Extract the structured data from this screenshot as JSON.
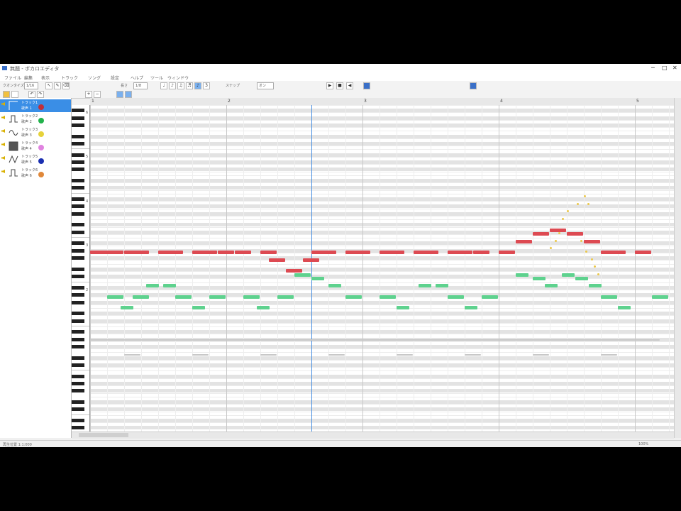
{
  "window": {
    "title": "無題 - ボカロエディタ",
    "minimize": "─",
    "maximize": "□",
    "close": "✕"
  },
  "menubar": [
    "ファイル",
    "編集",
    "表示",
    "トラック",
    "ソング",
    "設定",
    "ヘルプ",
    "ツール",
    "ウィンドウ"
  ],
  "toolbar": {
    "quantize_label": "クオンタイズ",
    "quantize_value": "1/16",
    "length_label": "長さ",
    "length_value": "1/8",
    "snap_label": "スナップ",
    "snap_value": "オン"
  },
  "tracks": [
    {
      "name": "トラック1",
      "sub": "歌声 1",
      "color": "#c0303a",
      "wave": "none",
      "selected": true
    },
    {
      "name": "トラック2",
      "sub": "歌声 2",
      "color": "#22b24c",
      "wave": "square",
      "selected": false
    },
    {
      "name": "トラック3",
      "sub": "歌声 3",
      "color": "#e6d23a",
      "wave": "sine",
      "selected": false
    },
    {
      "name": "トラック4",
      "sub": "歌声 4",
      "color": "#e083e0",
      "wave": "noise",
      "selected": false
    },
    {
      "name": "トラック5",
      "sub": "歌声 5",
      "color": "#1a2fb0",
      "wave": "triangle",
      "selected": false
    },
    {
      "name": "トラック6",
      "sub": "歌声 6",
      "color": "#e0883a",
      "wave": "square",
      "selected": false
    }
  ],
  "ruler": [
    "1",
    "2",
    "3",
    "4",
    "5"
  ],
  "octave_labels": [
    "6",
    "5",
    "4",
    "3",
    "2"
  ],
  "status": {
    "left": "再生位置 1:1:000",
    "right": "100%"
  },
  "notes": {
    "red": [
      {
        "start": 0,
        "len": 2,
        "pitch": 0
      },
      {
        "start": 2,
        "len": 1.5,
        "pitch": 0
      },
      {
        "start": 4,
        "len": 1.5,
        "pitch": 0
      },
      {
        "start": 6,
        "len": 1.5,
        "pitch": 0
      },
      {
        "start": 7.5,
        "len": 1,
        "pitch": 0
      },
      {
        "start": 8.5,
        "len": 1,
        "pitch": 0
      },
      {
        "start": 10,
        "len": 1,
        "pitch": 0
      },
      {
        "start": 10.5,
        "len": 1,
        "pitch": -2
      },
      {
        "start": 11.5,
        "len": 1,
        "pitch": -5
      },
      {
        "start": 12.5,
        "len": 1,
        "pitch": -2
      },
      {
        "start": 13,
        "len": 1.5,
        "pitch": 0
      },
      {
        "start": 15,
        "len": 1.5,
        "pitch": 0
      },
      {
        "start": 17,
        "len": 1.5,
        "pitch": 0
      },
      {
        "start": 19,
        "len": 1.5,
        "pitch": 0
      },
      {
        "start": 21,
        "len": 1.5,
        "pitch": 0
      },
      {
        "start": 22.5,
        "len": 1,
        "pitch": 0
      },
      {
        "start": 24,
        "len": 1,
        "pitch": 0
      },
      {
        "start": 25,
        "len": 1,
        "pitch": 3
      },
      {
        "start": 26,
        "len": 1,
        "pitch": 5
      },
      {
        "start": 27,
        "len": 1,
        "pitch": 6
      },
      {
        "start": 28,
        "len": 1,
        "pitch": 5
      },
      {
        "start": 29,
        "len": 1,
        "pitch": 3
      },
      {
        "start": 30,
        "len": 1.5,
        "pitch": 0
      },
      {
        "start": 32,
        "len": 1,
        "pitch": 0
      }
    ],
    "green": [
      {
        "start": 1,
        "len": 1,
        "pitch": -12
      },
      {
        "start": 1.8,
        "len": 0.8,
        "pitch": -15
      },
      {
        "start": 2.5,
        "len": 1,
        "pitch": -12
      },
      {
        "start": 3.3,
        "len": 0.8,
        "pitch": -9
      },
      {
        "start": 4.3,
        "len": 0.8,
        "pitch": -9
      },
      {
        "start": 5,
        "len": 1,
        "pitch": -12
      },
      {
        "start": 6,
        "len": 0.8,
        "pitch": -15
      },
      {
        "start": 7,
        "len": 1,
        "pitch": -12
      },
      {
        "start": 9,
        "len": 1,
        "pitch": -12
      },
      {
        "start": 9.8,
        "len": 0.8,
        "pitch": -15
      },
      {
        "start": 11,
        "len": 1,
        "pitch": -12
      },
      {
        "start": 12,
        "len": 1,
        "pitch": -6
      },
      {
        "start": 13,
        "len": 0.8,
        "pitch": -7
      },
      {
        "start": 14,
        "len": 0.8,
        "pitch": -9
      },
      {
        "start": 15,
        "len": 1,
        "pitch": -12
      },
      {
        "start": 17,
        "len": 1,
        "pitch": -12
      },
      {
        "start": 18,
        "len": 0.8,
        "pitch": -15
      },
      {
        "start": 19.3,
        "len": 0.8,
        "pitch": -9
      },
      {
        "start": 20.3,
        "len": 0.8,
        "pitch": -9
      },
      {
        "start": 21,
        "len": 1,
        "pitch": -12
      },
      {
        "start": 22,
        "len": 0.8,
        "pitch": -15
      },
      {
        "start": 23,
        "len": 1,
        "pitch": -12
      },
      {
        "start": 25,
        "len": 0.8,
        "pitch": -6
      },
      {
        "start": 26,
        "len": 0.8,
        "pitch": -7
      },
      {
        "start": 26.7,
        "len": 0.8,
        "pitch": -9
      },
      {
        "start": 27.7,
        "len": 0.8,
        "pitch": -6
      },
      {
        "start": 28.5,
        "len": 0.8,
        "pitch": -7
      },
      {
        "start": 29.3,
        "len": 0.8,
        "pitch": -9
      },
      {
        "start": 30,
        "len": 1,
        "pitch": -12
      },
      {
        "start": 31,
        "len": 0.8,
        "pitch": -15
      },
      {
        "start": 33,
        "len": 1,
        "pitch": -12
      }
    ],
    "yellow_curve": [
      [
        29.2,
        13
      ],
      [
        29.0,
        15
      ],
      [
        28.6,
        13
      ],
      [
        28.0,
        11
      ],
      [
        27.7,
        9
      ],
      [
        27.5,
        5
      ],
      [
        27.3,
        3
      ],
      [
        27.0,
        1
      ],
      [
        28.8,
        3
      ],
      [
        29.1,
        0
      ],
      [
        29.4,
        -2
      ],
      [
        29.6,
        -4
      ],
      [
        29.8,
        -6
      ]
    ],
    "gray": [
      {
        "start": 0,
        "len": 33.5,
        "pitch": -24
      },
      {
        "start": 2,
        "len": 1,
        "pitch": -28
      },
      {
        "start": 6,
        "len": 1,
        "pitch": -28
      },
      {
        "start": 10,
        "len": 1,
        "pitch": -28
      },
      {
        "start": 14,
        "len": 1,
        "pitch": -28
      },
      {
        "start": 18,
        "len": 1,
        "pitch": -28
      },
      {
        "start": 22,
        "len": 1,
        "pitch": -28
      },
      {
        "start": 26,
        "len": 1,
        "pitch": -28
      },
      {
        "start": 30,
        "len": 1,
        "pitch": -28
      }
    ]
  }
}
